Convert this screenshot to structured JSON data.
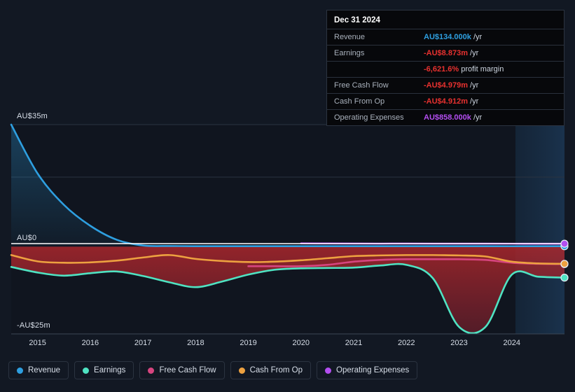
{
  "tooltip": {
    "title": "Dec 31 2024",
    "rows": [
      {
        "label": "Revenue",
        "amount": "AU$134.000k",
        "unit": "/yr",
        "color": "#2e9fe0"
      },
      {
        "label": "Earnings",
        "amount": "-AU$8.873m",
        "unit": "/yr",
        "color": "#e8312f"
      },
      {
        "label": "",
        "amount": "-6,621.6%",
        "unit": "profit margin",
        "color": "#e8312f"
      },
      {
        "label": "Free Cash Flow",
        "amount": "-AU$4.979m",
        "unit": "/yr",
        "color": "#e8312f"
      },
      {
        "label": "Cash From Op",
        "amount": "-AU$4.912m",
        "unit": "/yr",
        "color": "#e8312f"
      },
      {
        "label": "Operating Expenses",
        "amount": "AU$858.000k",
        "unit": "/yr",
        "color": "#b34ef0"
      }
    ]
  },
  "legend": [
    {
      "label": "Revenue",
      "color": "#2e9fe0"
    },
    {
      "label": "Earnings",
      "color": "#4fe3c2"
    },
    {
      "label": "Free Cash Flow",
      "color": "#d6457f"
    },
    {
      "label": "Cash From Op",
      "color": "#eda140"
    },
    {
      "label": "Operating Expenses",
      "color": "#b34ef0"
    }
  ],
  "axis": {
    "y_top": "AU$35m",
    "y_zero": "AU$0",
    "y_bottom": "-AU$25m",
    "x_ticks": [
      "2015",
      "2016",
      "2017",
      "2018",
      "2019",
      "2020",
      "2021",
      "2022",
      "2023",
      "2024"
    ]
  },
  "chart_data": {
    "type": "area",
    "title": "",
    "xlabel": "",
    "ylabel": "AU$",
    "ylim": [
      -25,
      35
    ],
    "grid": true,
    "legend_position": "bottom",
    "currency": "AUD",
    "x": [
      2014.5,
      2015,
      2015.5,
      2016,
      2016.5,
      2017,
      2017.5,
      2018,
      2018.5,
      2019,
      2019.5,
      2020,
      2020.5,
      2021,
      2021.5,
      2022,
      2022.5,
      2023,
      2023.5,
      2024,
      2024.5,
      2025
    ],
    "series": [
      {
        "name": "Revenue",
        "color": "#2e9fe0",
        "values": [
          35.0,
          21.0,
          12.0,
          6.0,
          2.0,
          0.35,
          0.2,
          0.15,
          0.14,
          0.14,
          0.14,
          0.14,
          0.14,
          0.14,
          0.14,
          0.14,
          0.14,
          0.14,
          0.14,
          0.134,
          0.134,
          0.134
        ]
      },
      {
        "name": "Earnings",
        "color": "#4fe3c2",
        "values": [
          -5.8,
          -7.4,
          -8.3,
          -7.6,
          -7.1,
          -8.4,
          -10.2,
          -11.6,
          -10.0,
          -8.0,
          -6.6,
          -6.2,
          -6.1,
          -6.0,
          -5.4,
          -5.2,
          -9.0,
          -23.0,
          -23.0,
          -8.0,
          -8.6,
          -8.873
        ]
      },
      {
        "name": "Free Cash Flow",
        "color": "#d6457f",
        "values": [
          null,
          null,
          null,
          null,
          null,
          null,
          null,
          null,
          null,
          -5.6,
          -5.6,
          -5.6,
          -5.2,
          -4.3,
          -3.8,
          -3.6,
          -3.6,
          -3.6,
          -3.8,
          -4.6,
          -4.9,
          -4.979
        ]
      },
      {
        "name": "Cash From Op",
        "color": "#eda140",
        "values": [
          -2.4,
          -4.2,
          -4.6,
          -4.5,
          -4.0,
          -3.1,
          -2.4,
          -3.5,
          -4.1,
          -4.4,
          -4.3,
          -3.9,
          -3.3,
          -2.7,
          -2.5,
          -2.4,
          -2.4,
          -2.5,
          -2.8,
          -4.3,
          -4.8,
          -4.912
        ]
      },
      {
        "name": "Operating Expenses",
        "color": "#b34ef0",
        "values": [
          null,
          null,
          null,
          null,
          null,
          null,
          null,
          null,
          null,
          null,
          null,
          0.95,
          0.92,
          0.9,
          0.88,
          0.9,
          0.88,
          0.87,
          0.87,
          0.86,
          0.858,
          0.858
        ]
      }
    ]
  }
}
